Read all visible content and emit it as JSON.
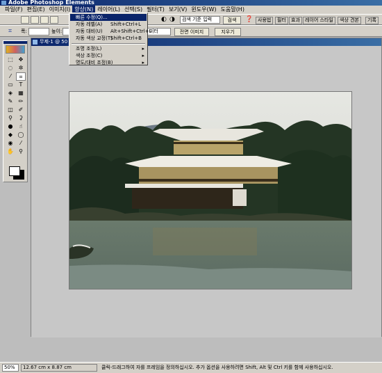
{
  "app": {
    "title": "Adobe Photoshop Elements"
  },
  "menubar": {
    "items": [
      "파일(F)",
      "편집(E)",
      "이미지(I)",
      "향상(N)",
      "레이어(L)",
      "선택(S)",
      "필터(T)",
      "보기(V)",
      "윈도우(W)",
      "도움말(H)"
    ]
  },
  "toolbar1": {
    "search_placeholder": "검색 기준 입력",
    "search_button": "검색",
    "tabs": [
      "사용법",
      "필터",
      "효과",
      "레이어 스타일",
      "색상 견본",
      "기록"
    ]
  },
  "toolbar2": {
    "width_label": "폭:",
    "height_label": "높이:",
    "resolution_select": "미터",
    "front_image_button": "전면 이미지",
    "clear_button": "지우기"
  },
  "enhance_menu": {
    "items": [
      {
        "label": "빠른 수정(Q)...",
        "shortcut": ""
      },
      {
        "label": "자동 레벨(A)",
        "shortcut": "Shift+Ctrl+L"
      },
      {
        "label": "자동 대비(U)",
        "shortcut": "Alt+Shift+Ctrl+L"
      },
      {
        "label": "자동 색상 교정(T)",
        "shortcut": "Shift+Ctrl+B"
      },
      {
        "label": "조명 조정(L)",
        "shortcut": ""
      },
      {
        "label": "색상 조정(C)",
        "shortcut": ""
      },
      {
        "label": "명도/대비 조정(B)",
        "shortcut": ""
      }
    ]
  },
  "document": {
    "title": "무제-1 @ 50"
  },
  "statusbar": {
    "zoom": "50%",
    "doc_size": "12.67 cm x 8.87 cm",
    "hint": "클릭-드래그하여 자를 프레임을 정의하십시오.  추가 옵션을 사용하려면 Shift, Alt 및 Ctrl 키를 함께 사용하십시오."
  },
  "colors": {
    "titlebar": "#0a246a",
    "menu_highlight": "#0a246a",
    "chrome": "#d4d0c8"
  }
}
